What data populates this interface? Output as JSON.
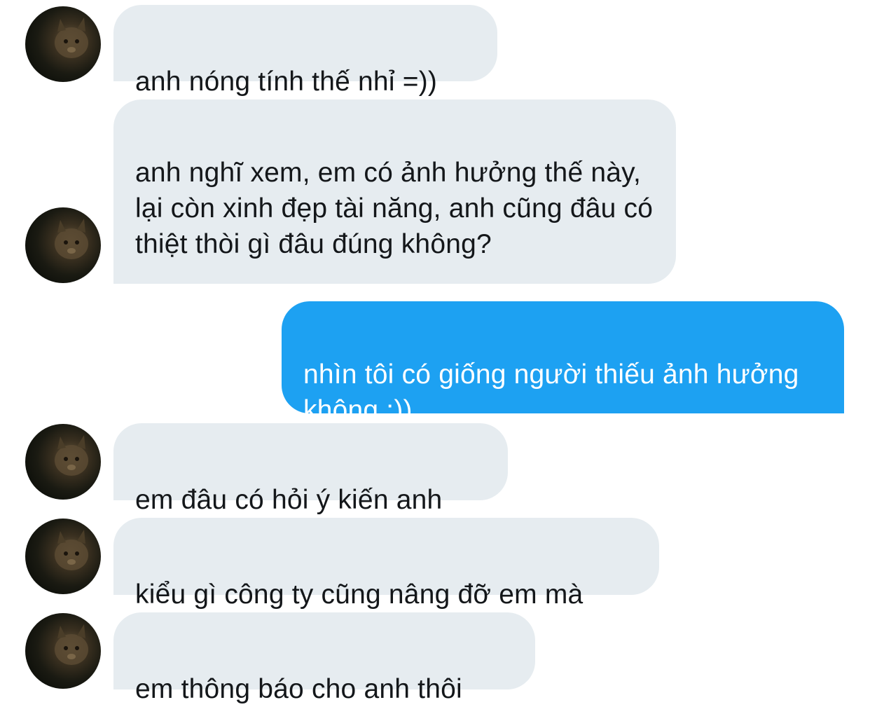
{
  "messages": [
    {
      "direction": "incoming",
      "text": "anh nóng tính thế nhỉ =))",
      "avatar": "cat-avatar"
    },
    {
      "direction": "incoming",
      "text": "anh nghĩ xem, em có ảnh hưởng thế này, lại còn xinh đẹp tài năng, anh cũng đâu có thiệt thòi gì đâu đúng không?",
      "avatar": "cat-avatar"
    },
    {
      "direction": "outgoing",
      "text": "nhìn tôi có giống người thiếu ảnh hưởng không :))"
    },
    {
      "direction": "incoming",
      "text": "em đâu có hỏi ý kiến anh",
      "avatar": "cat-avatar"
    },
    {
      "direction": "incoming",
      "text": "kiểu gì công ty cũng nâng đỡ em mà",
      "avatar": "cat-avatar"
    },
    {
      "direction": "incoming",
      "text": "em thông báo cho anh thôi",
      "avatar": "cat-avatar"
    }
  ],
  "colors": {
    "incoming_bubble": "#e6ecf0",
    "incoming_text": "#14171a",
    "outgoing_bubble": "#1da1f2",
    "outgoing_text": "#ffffff"
  }
}
